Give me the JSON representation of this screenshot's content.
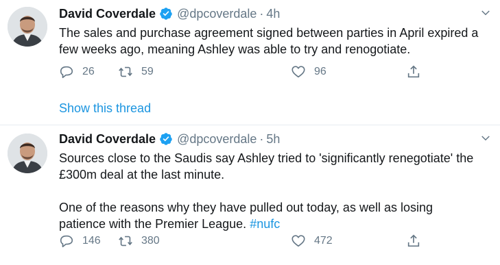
{
  "tweets": [
    {
      "author_name": "David Coverdale",
      "handle": "@dpcoverdale",
      "separator": "·",
      "time": "4h",
      "text_lines": [
        "The sales and purchase agreement signed between parties in April expired a",
        "few weeks ago, meaning Ashley was able to try and renogotiate."
      ],
      "reply_count": "26",
      "retweet_count": "59",
      "like_count": "96",
      "show_thread": "Show this thread"
    },
    {
      "author_name": "David Coverdale",
      "handle": "@dpcoverdale",
      "separator": "·",
      "time": "5h",
      "paragraph1": [
        "Sources close to the Saudis say Ashley tried to 'significantly renegotiate' the",
        "£300m deal at the last minute."
      ],
      "paragraph2_line1": "One of the reasons why they have pulled out today, as well as losing",
      "paragraph2_line2": "patience with the Premier League.",
      "hashtag": "#nufc",
      "reply_count": "146",
      "retweet_count": "380",
      "like_count": "472"
    }
  ],
  "icons": {
    "verified": "verified-badge-icon",
    "caret": "chevron-down-icon",
    "reply": "reply-icon",
    "retweet": "retweet-icon",
    "like": "heart-icon",
    "share": "share-icon"
  },
  "colors": {
    "accent": "#1b95e0",
    "secondary_text": "#657786",
    "divider": "#e6ecf0"
  }
}
